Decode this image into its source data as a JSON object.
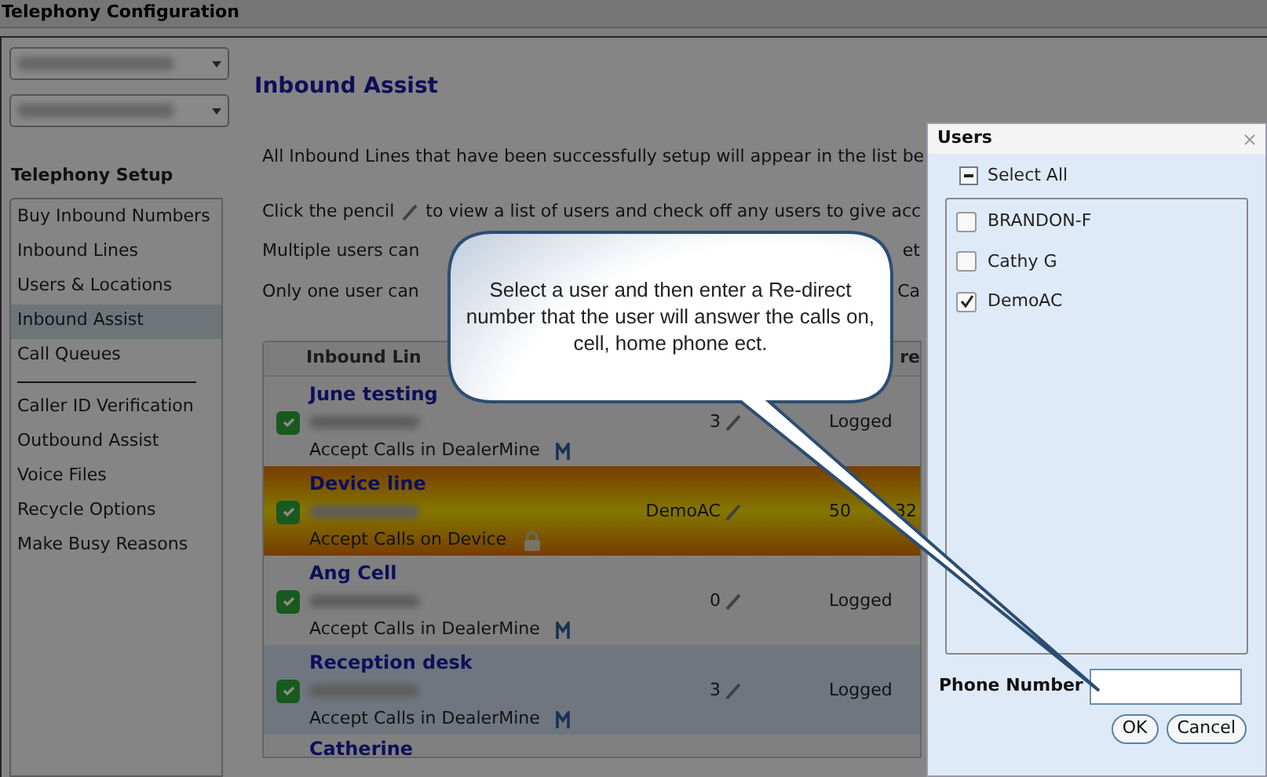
{
  "window": {
    "title": "Telephony Configuration"
  },
  "sidebar": {
    "heading": "Telephony Setup",
    "items": [
      {
        "label": "Buy Inbound Numbers",
        "selected": false,
        "kind": "link"
      },
      {
        "label": "Inbound Lines",
        "selected": false,
        "kind": "link"
      },
      {
        "label": "Users & Locations",
        "selected": false,
        "kind": "link"
      },
      {
        "label": "Inbound Assist",
        "selected": true,
        "kind": "link"
      },
      {
        "label": "Call Queues",
        "selected": false,
        "kind": "link"
      },
      {
        "kind": "divider"
      },
      {
        "label": "Caller ID Verification",
        "selected": false,
        "kind": "link"
      },
      {
        "label": "Outbound Assist",
        "selected": false,
        "kind": "link"
      },
      {
        "label": "Voice Files",
        "selected": false,
        "kind": "link"
      },
      {
        "label": "Recycle Options",
        "selected": false,
        "kind": "link"
      },
      {
        "label": "Make Busy Reasons",
        "selected": false,
        "kind": "link"
      }
    ]
  },
  "main": {
    "title": "Inbound Assist",
    "intro": "All Inbound Lines that have been successfully setup will appear in the list be",
    "pencil_line": {
      "before": "Click the pencil",
      "after": "to view a list of users and check off any users to give acc"
    },
    "notes": [
      {
        "left": "Multiple users can",
        "right": "et"
      },
      {
        "left": "Only one user can",
        "right": "Ca"
      }
    ],
    "table": {
      "columns": [
        "Inbound Lin",
        "re"
      ],
      "rows": [
        {
          "name": "June testing",
          "active": true,
          "mode": "Accept Calls in DealerMine",
          "locked": false,
          "users": "3",
          "status": "Logged",
          "selected": false,
          "hovered": false
        },
        {
          "name": "Device line",
          "active": true,
          "mode": "Accept Calls on Device",
          "locked": true,
          "users": "DemoAC",
          "status": "50",
          "status_tail": "32",
          "selected": true,
          "hovered": false
        },
        {
          "name": "Ang Cell",
          "active": true,
          "mode": "Accept Calls in DealerMine",
          "locked": false,
          "users": "0",
          "status": "Logged",
          "selected": false,
          "hovered": false
        },
        {
          "name": "Reception desk",
          "active": true,
          "mode": "Accept Calls in DealerMine",
          "locked": false,
          "users": "3",
          "status": "Logged",
          "selected": false,
          "hovered": true
        },
        {
          "name": "Catherine"
        }
      ]
    }
  },
  "callout": {
    "text": "Select a user and then enter a Re-direct number that the user will answer the calls on, cell, home phone ect."
  },
  "dialog": {
    "title": "Users",
    "select_all": {
      "label": "Select All",
      "indeterminate": true
    },
    "users": [
      {
        "label": "BRANDON-F",
        "checked": false
      },
      {
        "label": "Cathy G",
        "checked": false
      },
      {
        "label": "DemoAC",
        "checked": true
      }
    ],
    "phone_label": "Phone Number",
    "buttons": [
      "OK",
      "Cancel"
    ]
  }
}
